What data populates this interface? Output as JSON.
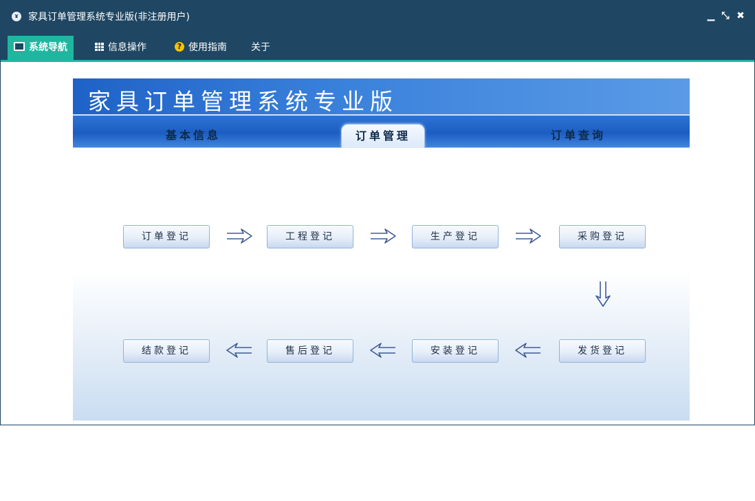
{
  "window": {
    "title": "家具订单管理系统专业版(非注册用户)",
    "controls": [
      "minimize",
      "restore",
      "close"
    ]
  },
  "menubar": {
    "items": [
      {
        "label": "系统导航",
        "icon": "monitor-icon",
        "active": true
      },
      {
        "label": "信息操作",
        "icon": "grid-icon",
        "active": false
      },
      {
        "label": "使用指南",
        "icon": "help-icon",
        "active": false
      },
      {
        "label": "关于",
        "icon": "",
        "active": false
      }
    ]
  },
  "banner": {
    "title": "家具订单管理系统专业版"
  },
  "tabs": [
    {
      "label": "基本信息",
      "active": false
    },
    {
      "label": "订单管理",
      "active": true
    },
    {
      "label": "订单查询",
      "active": false
    }
  ],
  "workflow": {
    "row1": [
      "订单登记",
      "工程登记",
      "生产登记",
      "采购登记"
    ],
    "row2": [
      "结款登记",
      "售后登记",
      "安装登记",
      "发货登记"
    ]
  },
  "colors": {
    "titlebar": "#1f4662",
    "accent": "#1fb6a0",
    "banner": "#3b82dc",
    "arrow": "#3e5a94"
  }
}
